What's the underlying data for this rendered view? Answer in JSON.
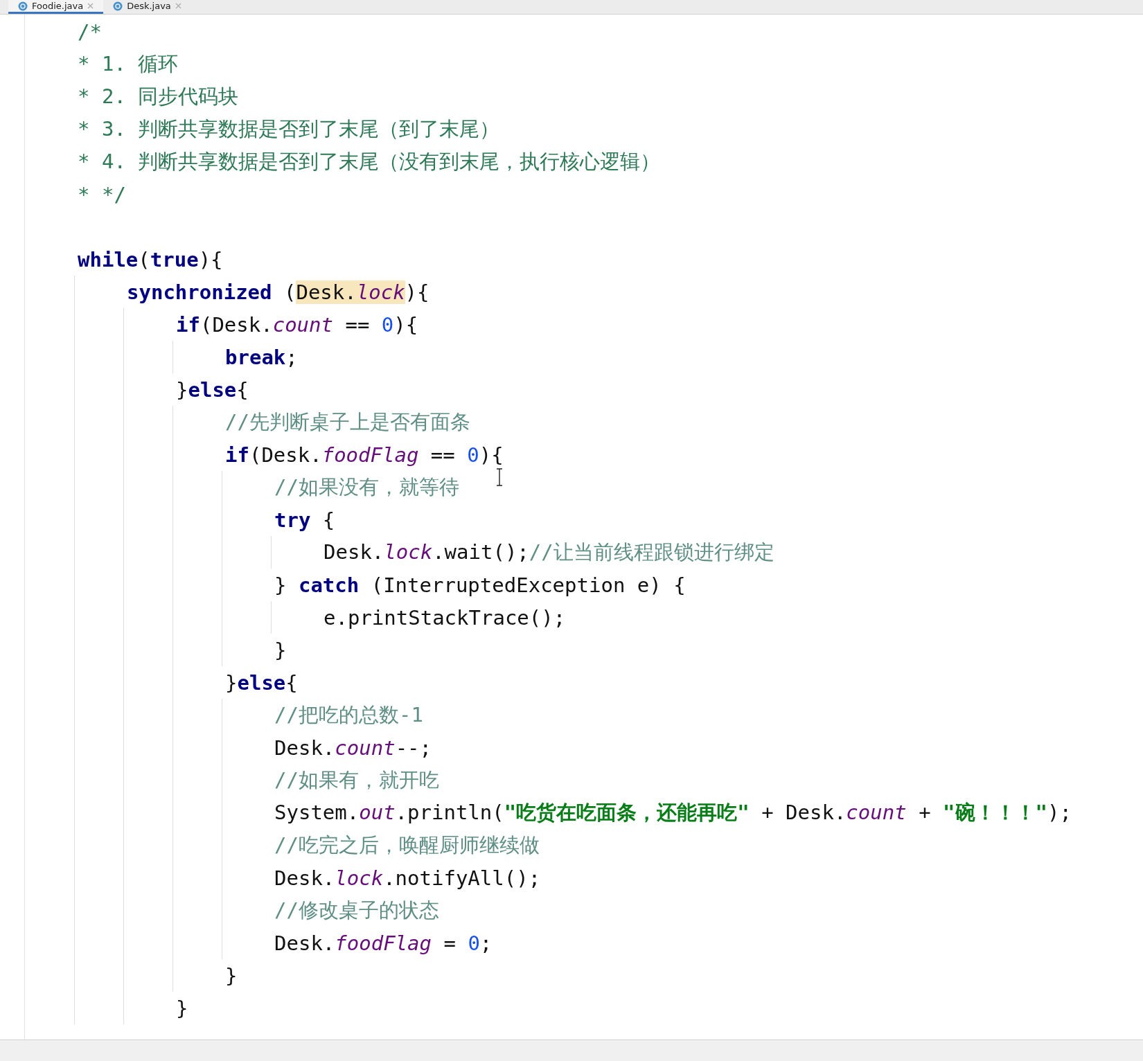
{
  "tabs": [
    {
      "label": "Foodie.java",
      "selected": true
    },
    {
      "label": "Desk.java",
      "selected": false
    }
  ],
  "editor": {
    "lines": [
      {
        "kind": "code",
        "tokens": [
          {
            "kind": "doc",
            "text": "/*"
          }
        ]
      },
      {
        "kind": "code",
        "tokens": [
          {
            "kind": "doc",
            "text": "* 1. 循环"
          }
        ]
      },
      {
        "kind": "code",
        "tokens": [
          {
            "kind": "doc",
            "text": "* 2. 同步代码块"
          }
        ]
      },
      {
        "kind": "code",
        "tokens": [
          {
            "kind": "doc",
            "text": "* 3. 判断共享数据是否到了末尾（到了末尾）"
          }
        ]
      },
      {
        "kind": "code",
        "tokens": [
          {
            "kind": "doc",
            "text": "* 4. 判断共享数据是否到了末尾（没有到末尾，执行核心逻辑）"
          }
        ]
      },
      {
        "kind": "code",
        "tokens": [
          {
            "kind": "doc",
            "text": "* */"
          }
        ]
      },
      {
        "kind": "blank"
      },
      {
        "kind": "code",
        "tokens": [
          {
            "kind": "keyword",
            "text": "while"
          },
          {
            "kind": "plain",
            "text": "("
          },
          {
            "kind": "keyword",
            "text": "true"
          },
          {
            "kind": "plain",
            "text": "){"
          }
        ],
        "children": [
          {
            "kind": "code",
            "tokens": [
              {
                "kind": "keyword",
                "text": "synchronized"
              },
              {
                "kind": "plain",
                "text": " ("
              },
              {
                "kind": "match",
                "tokens": [
                  {
                    "kind": "plain",
                    "text": "Desk."
                  },
                  {
                    "kind": "field",
                    "text": "lock"
                  }
                ]
              },
              {
                "kind": "plain",
                "text": "){"
              }
            ],
            "children": [
              {
                "kind": "code",
                "tokens": [
                  {
                    "kind": "keyword",
                    "text": "if"
                  },
                  {
                    "kind": "plain",
                    "text": "(Desk."
                  },
                  {
                    "kind": "field",
                    "text": "count"
                  },
                  {
                    "kind": "plain",
                    "text": " == "
                  },
                  {
                    "kind": "number",
                    "text": "0"
                  },
                  {
                    "kind": "plain",
                    "text": "){"
                  }
                ],
                "children": [
                  {
                    "kind": "code",
                    "tokens": [
                      {
                        "kind": "keyword",
                        "text": "break"
                      },
                      {
                        "kind": "plain",
                        "text": ";"
                      }
                    ]
                  }
                ]
              },
              {
                "kind": "code",
                "tokens": [
                  {
                    "kind": "plain",
                    "text": "}"
                  },
                  {
                    "kind": "keyword",
                    "text": "else"
                  },
                  {
                    "kind": "plain",
                    "text": "{"
                  }
                ],
                "children": [
                  {
                    "kind": "code",
                    "tokens": [
                      {
                        "kind": "comment",
                        "text": "//先判断桌子上是否有面条"
                      }
                    ]
                  },
                  {
                    "kind": "code",
                    "tokens": [
                      {
                        "kind": "keyword",
                        "text": "if"
                      },
                      {
                        "kind": "plain",
                        "text": "(Desk."
                      },
                      {
                        "kind": "field",
                        "text": "foodFlag"
                      },
                      {
                        "kind": "plain",
                        "text": " == "
                      },
                      {
                        "kind": "number",
                        "text": "0"
                      },
                      {
                        "kind": "plain",
                        "text": "){"
                      }
                    ],
                    "children": [
                      {
                        "kind": "code",
                        "tokens": [
                          {
                            "kind": "comment",
                            "text": "//如果没有，就等待"
                          }
                        ]
                      },
                      {
                        "kind": "code",
                        "tokens": [
                          {
                            "kind": "keyword",
                            "text": "try"
                          },
                          {
                            "kind": "plain",
                            "text": " {"
                          }
                        ],
                        "children": [
                          {
                            "kind": "code",
                            "tokens": [
                              {
                                "kind": "plain",
                                "text": "Desk."
                              },
                              {
                                "kind": "field",
                                "text": "lock"
                              },
                              {
                                "kind": "plain",
                                "text": ".wait();"
                              },
                              {
                                "kind": "comment",
                                "text": "//让当前线程跟锁进行绑定"
                              }
                            ]
                          }
                        ]
                      },
                      {
                        "kind": "code",
                        "tokens": [
                          {
                            "kind": "plain",
                            "text": "} "
                          },
                          {
                            "kind": "keyword",
                            "text": "catch"
                          },
                          {
                            "kind": "plain",
                            "text": " (InterruptedException e) {"
                          }
                        ],
                        "children": [
                          {
                            "kind": "code",
                            "tokens": [
                              {
                                "kind": "plain",
                                "text": "e.printStackTrace();"
                              }
                            ]
                          }
                        ]
                      },
                      {
                        "kind": "code",
                        "tokens": [
                          {
                            "kind": "plain",
                            "text": "}"
                          }
                        ]
                      }
                    ]
                  },
                  {
                    "kind": "code",
                    "tokens": [
                      {
                        "kind": "plain",
                        "text": "}"
                      },
                      {
                        "kind": "keyword",
                        "text": "else"
                      },
                      {
                        "kind": "plain",
                        "text": "{"
                      }
                    ],
                    "children": [
                      {
                        "kind": "code",
                        "tokens": [
                          {
                            "kind": "comment",
                            "text": "//把吃的总数-1"
                          }
                        ]
                      },
                      {
                        "kind": "code",
                        "tokens": [
                          {
                            "kind": "plain",
                            "text": "Desk."
                          },
                          {
                            "kind": "field",
                            "text": "count"
                          },
                          {
                            "kind": "plain",
                            "text": "--;"
                          }
                        ]
                      },
                      {
                        "kind": "code",
                        "tokens": [
                          {
                            "kind": "comment",
                            "text": "//如果有，就开吃"
                          }
                        ]
                      },
                      {
                        "kind": "code",
                        "tokens": [
                          {
                            "kind": "plain",
                            "text": "System."
                          },
                          {
                            "kind": "field",
                            "text": "out"
                          },
                          {
                            "kind": "plain",
                            "text": ".println("
                          },
                          {
                            "kind": "string",
                            "text": "\"吃货在吃面条，还能再吃\""
                          },
                          {
                            "kind": "plain",
                            "text": " + Desk."
                          },
                          {
                            "kind": "field",
                            "text": "count"
                          },
                          {
                            "kind": "plain",
                            "text": " + "
                          },
                          {
                            "kind": "string",
                            "text": "\"碗！！！\""
                          },
                          {
                            "kind": "plain",
                            "text": ");"
                          }
                        ]
                      },
                      {
                        "kind": "code",
                        "tokens": [
                          {
                            "kind": "comment",
                            "text": "//吃完之后，唤醒厨师继续做"
                          }
                        ]
                      },
                      {
                        "kind": "code",
                        "tokens": [
                          {
                            "kind": "plain",
                            "text": "Desk."
                          },
                          {
                            "kind": "field",
                            "text": "lock"
                          },
                          {
                            "kind": "plain",
                            "text": ".notifyAll();"
                          }
                        ]
                      },
                      {
                        "kind": "code",
                        "tokens": [
                          {
                            "kind": "comment",
                            "text": "//修改桌子的状态"
                          }
                        ]
                      },
                      {
                        "kind": "code",
                        "tokens": [
                          {
                            "kind": "plain",
                            "text": "Desk."
                          },
                          {
                            "kind": "field",
                            "text": "foodFlag"
                          },
                          {
                            "kind": "plain",
                            "text": " = "
                          },
                          {
                            "kind": "number",
                            "text": "0"
                          },
                          {
                            "kind": "plain",
                            "text": ";"
                          }
                        ]
                      }
                    ]
                  },
                  {
                    "kind": "code",
                    "tokens": [
                      {
                        "kind": "plain",
                        "text": "}"
                      }
                    ]
                  }
                ]
              },
              {
                "kind": "code",
                "tokens": [
                  {
                    "kind": "plain",
                    "text": "}"
                  }
                ]
              }
            ]
          }
        ]
      }
    ]
  }
}
